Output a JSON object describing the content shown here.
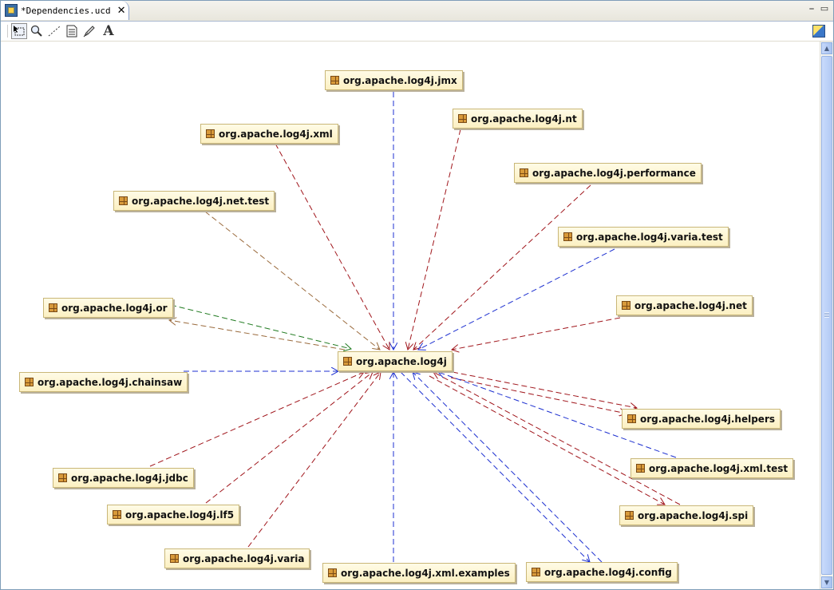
{
  "tab": {
    "title": "*Dependencies.ucd",
    "close": "✕",
    "icon": "class-diagram-icon"
  },
  "window_buttons": {
    "minimize": "⎯",
    "maximize": "▭"
  },
  "toolbar": {
    "tools": [
      {
        "name": "select-tool",
        "icon": "selection-icon"
      },
      {
        "name": "zoom-tool",
        "icon": "magnifier-icon"
      },
      {
        "name": "dependency-tool",
        "icon": "dotted-line-icon"
      },
      {
        "name": "note-tool",
        "icon": "note-icon"
      },
      {
        "name": "link-note-tool",
        "icon": "pen-icon"
      },
      {
        "name": "text-tool",
        "icon": "text-A-icon",
        "glyph": "A"
      }
    ],
    "right_icon": "cube-icon"
  },
  "colors": {
    "blue": "#1c2fd0",
    "red": "#a0151b",
    "green": "#1f7a1f",
    "brown": "#9a6a3c"
  },
  "diagram": {
    "center": "org.apache.log4j",
    "packages": [
      "org.apache.log4j.jmx",
      "org.apache.log4j.nt",
      "org.apache.log4j.xml",
      "org.apache.log4j.performance",
      "org.apache.log4j.net.test",
      "org.apache.log4j.varia.test",
      "org.apache.log4j.net",
      "org.apache.log4j.or",
      "org.apache.log4j",
      "org.apache.log4j.chainsaw",
      "org.apache.log4j.helpers",
      "org.apache.log4j.xml.test",
      "org.apache.log4j.jdbc",
      "org.apache.log4j.lf5",
      "org.apache.log4j.spi",
      "org.apache.log4j.varia",
      "org.apache.log4j.xml.examples",
      "org.apache.log4j.config"
    ]
  }
}
